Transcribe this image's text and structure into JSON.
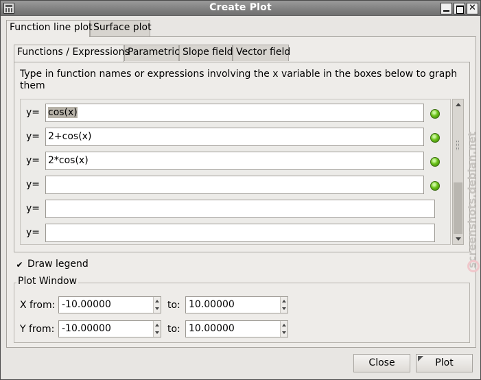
{
  "window": {
    "title": "Create Plot"
  },
  "outer_tabs": [
    {
      "label": "Function line plot",
      "active": true
    },
    {
      "label": "Surface plot",
      "active": false
    }
  ],
  "inner_tabs": [
    {
      "label": "Functions / Expressions",
      "active": true
    },
    {
      "label": "Parametric",
      "active": false
    },
    {
      "label": "Slope field",
      "active": false
    },
    {
      "label": "Vector field",
      "active": false
    }
  ],
  "instructions": "Type in function names or expressions involving the x variable in the boxes below to graph them",
  "functions": {
    "label": "y=",
    "rows": [
      {
        "value": "cos(x)",
        "indicator": true
      },
      {
        "value": "2+cos(x)",
        "indicator": true
      },
      {
        "value": "2*cos(x)",
        "indicator": true
      },
      {
        "value": "",
        "indicator": true
      },
      {
        "value": "",
        "indicator": false
      },
      {
        "value": "",
        "indicator": false
      }
    ],
    "indicator_color": "#5fb31a"
  },
  "draw_legend": {
    "label": "Draw legend",
    "checked": true
  },
  "plot_window": {
    "title": "Plot Window",
    "x_from_label": "X from:",
    "y_from_label": "Y from:",
    "to_label": "to:",
    "x_from": "-10.00000",
    "x_to": "10.00000",
    "y_from": "-10.00000",
    "y_to": "10.00000"
  },
  "buttons": {
    "close": "Close",
    "plot": "Plot"
  },
  "watermark": "screenshots.debian.net"
}
